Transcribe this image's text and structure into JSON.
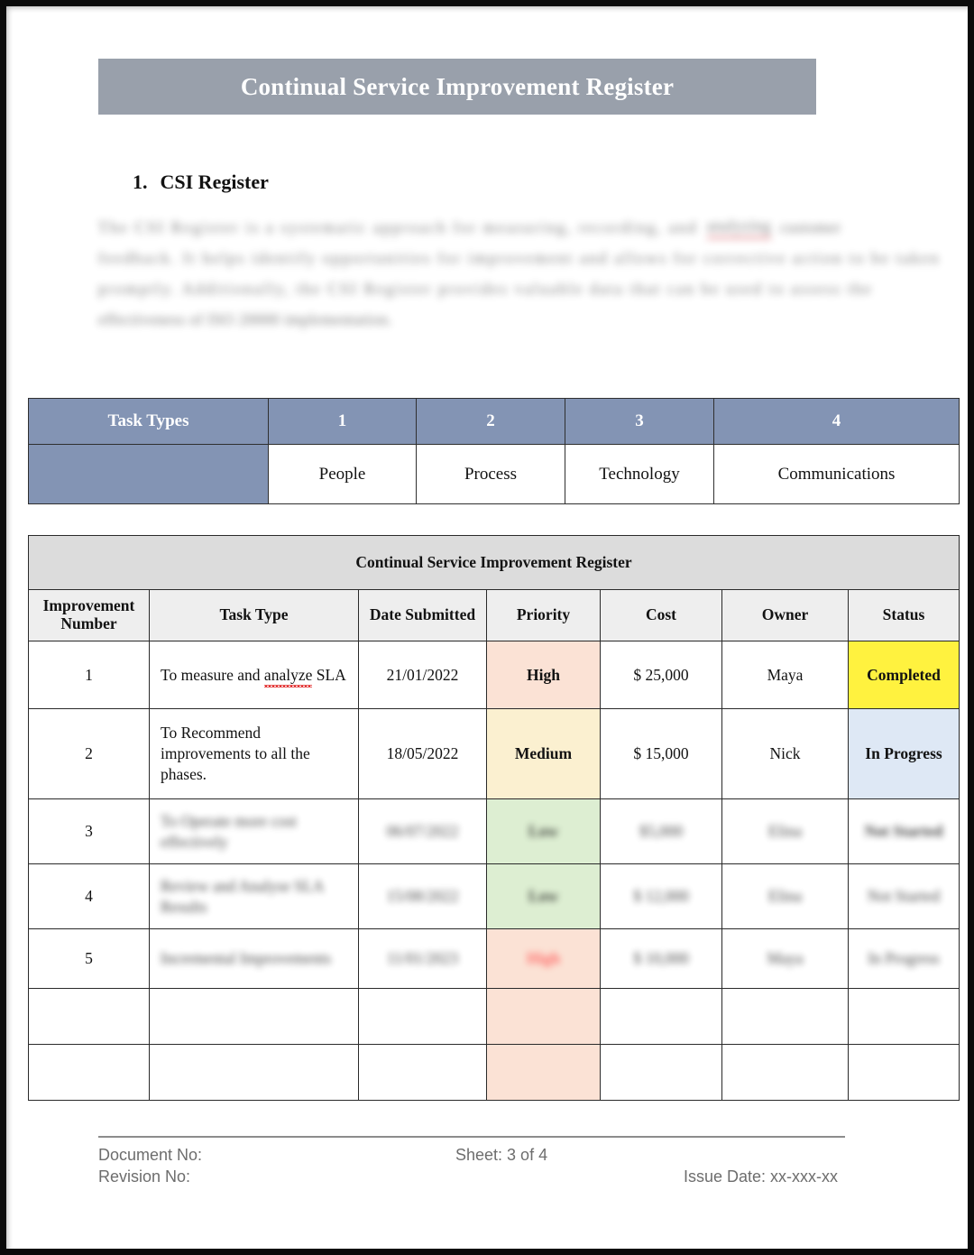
{
  "document": {
    "banner_title": "Continual Service Improvement Register",
    "section": {
      "number": "1.",
      "heading": "CSI Register"
    },
    "intro_paragraph": {
      "blurred": true,
      "lines": [
        "The CSI Register is a systematic approach for measuring, recording, and",
        "feedback. It helps identify opportunities for improvement and allows for corrective action to be taken",
        "promptly. Additionally, the CSI Register provides valuable data that can be used to assess the",
        "effectiveness of ISO 20000 implementation."
      ],
      "misspelled_word": "analyzing",
      "trailing_word": "customer"
    }
  },
  "task_types_table": {
    "row_label": "Task Types",
    "indices": [
      "1",
      "2",
      "3",
      "4"
    ],
    "values": [
      "People",
      "Process",
      "Technology",
      "Communications"
    ],
    "header_fill": "#8394B4",
    "header_text_color": "#FFFFFF"
  },
  "register_table": {
    "title": "Continual Service Improvement Register",
    "title_fill": "#DCDCDC",
    "header_fill": "#EEEEEE",
    "columns": [
      "Improvement Number",
      "Task Type",
      "Date Submitted",
      "Priority",
      "Cost",
      "Owner",
      "Status"
    ],
    "rows": [
      {
        "number": "1",
        "task_type": "To measure and analyze SLA",
        "task_type_misspelled": "analyze",
        "date_submitted": "21/01/2022",
        "priority": "High",
        "priority_fill": "#FBE2D5",
        "priority_color": "#FF0000",
        "cost": "$ 25,000",
        "owner": "Maya",
        "status": "Completed",
        "status_fill": "#FFF23F",
        "status_color": "#1F3864",
        "blurred": false
      },
      {
        "number": "2",
        "task_type": "To Recommend improvements to all the phases.",
        "date_submitted": "18/05/2022",
        "priority": "Medium",
        "priority_fill": "#FBF0D0",
        "priority_color": "#806000",
        "cost": "$ 15,000",
        "owner": "Nick",
        "status": "In Progress",
        "status_fill": "#DEE8F5",
        "status_color": "#ED7D31",
        "blurred": false
      },
      {
        "number": "3",
        "task_type": "To Operate more cost effectively",
        "date_submitted": "06/07/2022",
        "priority": "Low",
        "priority_fill": "#DDEED2",
        "priority_color": "#4A7A37",
        "cost": "$5,000",
        "owner": "Elina",
        "status": "Not Started",
        "status_color": "#FF4D4D",
        "blurred": true
      },
      {
        "number": "4",
        "task_type": "Review and Analyse SLA Results",
        "date_submitted": "15/08/2022",
        "priority": "Low",
        "priority_fill": "#DDEED2",
        "priority_color": "#4A7A37",
        "cost": "$ 12,000",
        "owner": "Elina",
        "status": "Not Started",
        "blurred": true
      },
      {
        "number": "5",
        "task_type": "Incremental Improvements",
        "date_submitted": "11/01/2023",
        "priority": "High",
        "priority_fill": "#FBE2D5",
        "priority_color": "#FF4D4D",
        "cost": "$ 10,000",
        "owner": "Maya",
        "status": "In Progress",
        "blurred": true
      },
      {
        "number": "",
        "task_type": "",
        "date_submitted": "",
        "priority": "",
        "priority_fill": "#FBE2D5",
        "cost": "",
        "owner": "",
        "status": "",
        "blurred": false
      },
      {
        "number": "",
        "task_type": "",
        "date_submitted": "",
        "priority": "",
        "priority_fill": "#FBE2D5",
        "cost": "",
        "owner": "",
        "status": "",
        "blurred": false
      }
    ]
  },
  "footer": {
    "document_no_label": "Document No:",
    "revision_no_label": "Revision No:",
    "sheet_label": "Sheet: 3 of 4",
    "issue_date_label": "Issue Date: xx-xxx-xx"
  }
}
